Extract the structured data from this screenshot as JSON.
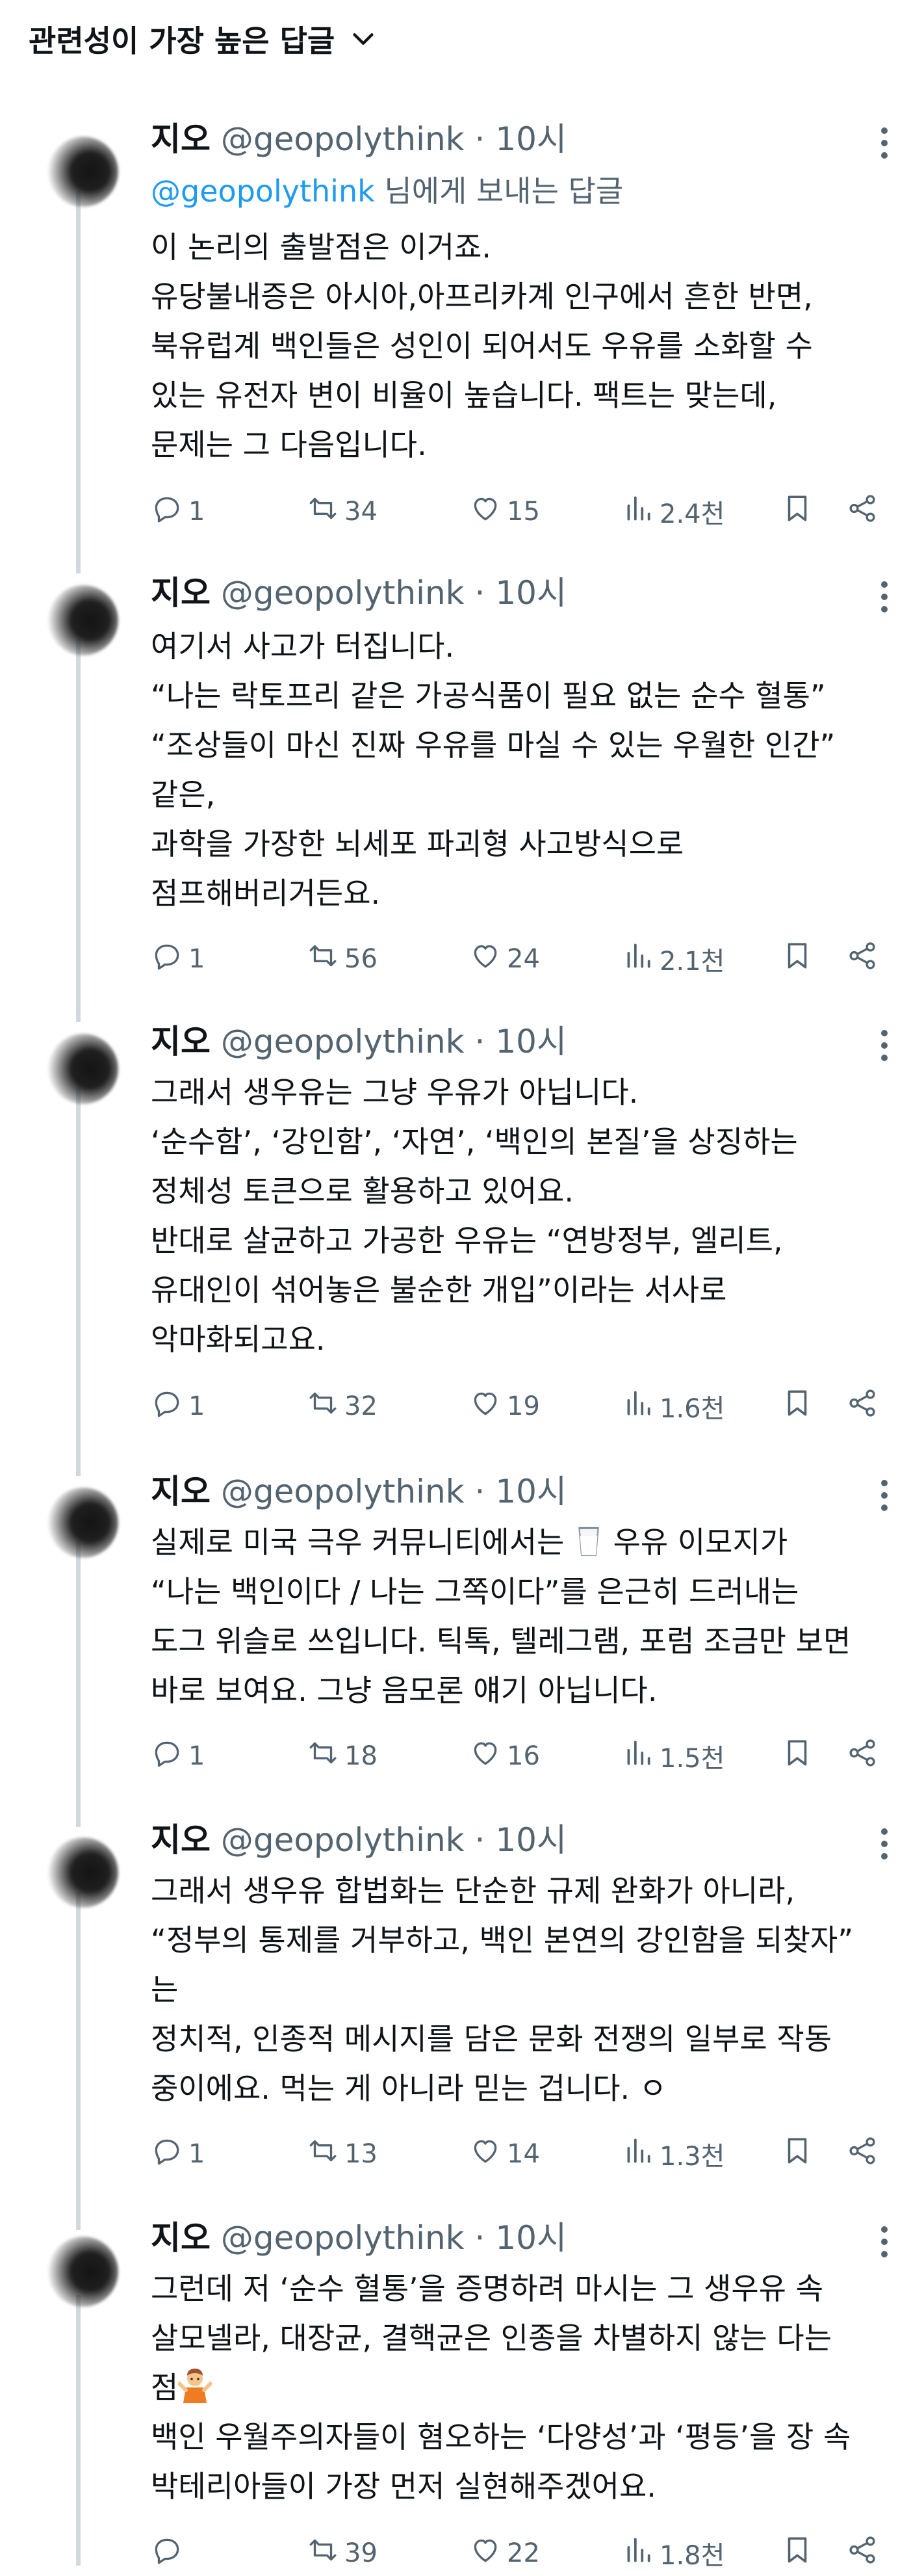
{
  "header": {
    "sort_label": "관련성이 가장 높은 답글"
  },
  "icons": {
    "sort": "chevron-down-icon",
    "more": "more-options-icon",
    "reply": "reply-icon",
    "retweet": "retweet-icon",
    "like": "heart-icon",
    "views": "views-chart-icon",
    "bookmark": "bookmark-icon",
    "share": "share-icon"
  },
  "colors": {
    "text": "#0f1419",
    "secondary": "#536471",
    "link": "#1d9bf0",
    "thread_line": "#cfd9de"
  },
  "tweets": [
    {
      "name": "지오",
      "handle": "@geopolythink",
      "dot": "·",
      "time": "10시",
      "reply_to": {
        "mention": "@geopolythink",
        "suffix": "님에게 보내는 답글"
      },
      "lines": [
        "이 논리의 출발점은 이거죠.",
        "유당불내증은 아시아,아프리카계 인구에서 흔한 반면,",
        "북유럽계 백인들은 성인이 되어서도 우유를 소화할 수",
        "있는 유전자 변이 비율이 높습니다. 팩트는 맞는데,",
        "문제는 그 다음입니다."
      ],
      "replies": "1",
      "retweets": "34",
      "likes": "15",
      "views": "2.4천"
    },
    {
      "name": "지오",
      "handle": "@geopolythink",
      "dot": "·",
      "time": "10시",
      "lines": [
        "여기서 사고가 터집니다.",
        "“나는 락토프리 같은 가공식품이 필요 없는 순수 혈통”",
        "“조상들이 마신 진짜 우유를 마실 수 있는 우월한 인간”",
        "같은,",
        "과학을 가장한 뇌세포 파괴형 사고방식으로",
        "점프해버리거든요."
      ],
      "replies": "1",
      "retweets": "56",
      "likes": "24",
      "views": "2.1천"
    },
    {
      "name": "지오",
      "handle": "@geopolythink",
      "dot": "·",
      "time": "10시",
      "lines": [
        "그래서 생우유는 그냥 우유가 아닙니다.",
        "‘순수함’, ‘강인함’, ‘자연’, ‘백인의 본질’을 상징하는",
        "정체성 토큰으로 활용하고 있어요.",
        "반대로 살균하고 가공한 우유는 “연방정부, 엘리트,",
        "유대인이 섞어놓은 불순한 개입”이라는 서사로",
        "악마화되고요."
      ],
      "replies": "1",
      "retweets": "32",
      "likes": "19",
      "views": "1.6천"
    },
    {
      "name": "지오",
      "handle": "@geopolythink",
      "dot": "·",
      "time": "10시",
      "line1_before": "실제로 미국 극우 커뮤니티에서는 ",
      "line1_after": " 우유 이모지가",
      "lines": [
        "“나는 백인이다 / 나는 그쪽이다”를 은근히 드러내는",
        "도그 위슬로 쓰입니다. 틱톡, 텔레그램, 포럼 조금만 보면",
        "바로 보여요. 그냥 음모론 얘기 아닙니다."
      ],
      "replies": "1",
      "retweets": "18",
      "likes": "16",
      "views": "1.5천"
    },
    {
      "name": "지오",
      "handle": "@geopolythink",
      "dot": "·",
      "time": "10시",
      "lines": [
        "그래서 생우유 합법화는 단순한 규제 완화가 아니라,",
        "“정부의 통제를 거부하고, 백인 본연의 강인함을 되찾자”",
        "는",
        "정치적, 인종적 메시지를 담은 문화 전쟁의 일부로 작동",
        "중이에요. 먹는 게 아니라 믿는 겁니다. ㅇ"
      ],
      "replies": "1",
      "retweets": "13",
      "likes": "14",
      "views": "1.3천"
    },
    {
      "name": "지오",
      "handle": "@geopolythink",
      "dot": "·",
      "time": "10시",
      "lines": [
        "그런데 저 ‘순수 혈통’을 증명하려 마시는 그 생우유 속",
        "살모넬라, 대장균, 결핵균은 인종을 차별하지 않는 다는"
      ],
      "line3": "점",
      "lines_after": [
        "백인 우월주의자들이 혐오하는 ‘다양성’과 ‘평등’을 장 속",
        "박테리아들이 가장 먼저 실현해주겠어요."
      ],
      "replies": "",
      "retweets": "39",
      "likes": "22",
      "views": "1.8천"
    }
  ]
}
